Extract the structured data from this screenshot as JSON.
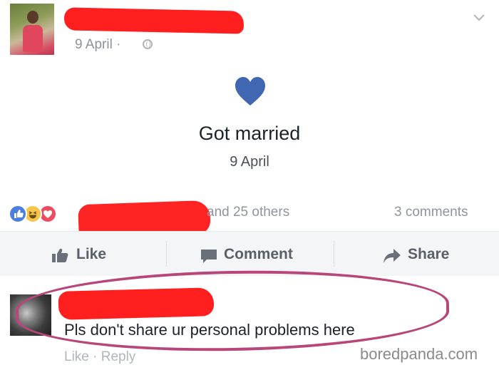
{
  "post": {
    "date": "9 April",
    "date_separator": "·"
  },
  "event": {
    "title": "Got married",
    "date": "9 April",
    "icon": "heart-icon",
    "icon_color": "#4267b2"
  },
  "reactions": {
    "types": [
      "like",
      "haha",
      "love"
    ],
    "others_text": "and 25 others",
    "comments_text": "3 comments"
  },
  "actions": {
    "like_label": "Like",
    "comment_label": "Comment",
    "share_label": "Share"
  },
  "comment": {
    "text": "Pls don't share ur personal problems here",
    "actions_text": "Like · Reply"
  },
  "watermark": "boredpanda.com",
  "colors": {
    "redaction": "#ff1f1f",
    "highlight": "#b9467a",
    "muted_text": "#90949c"
  }
}
